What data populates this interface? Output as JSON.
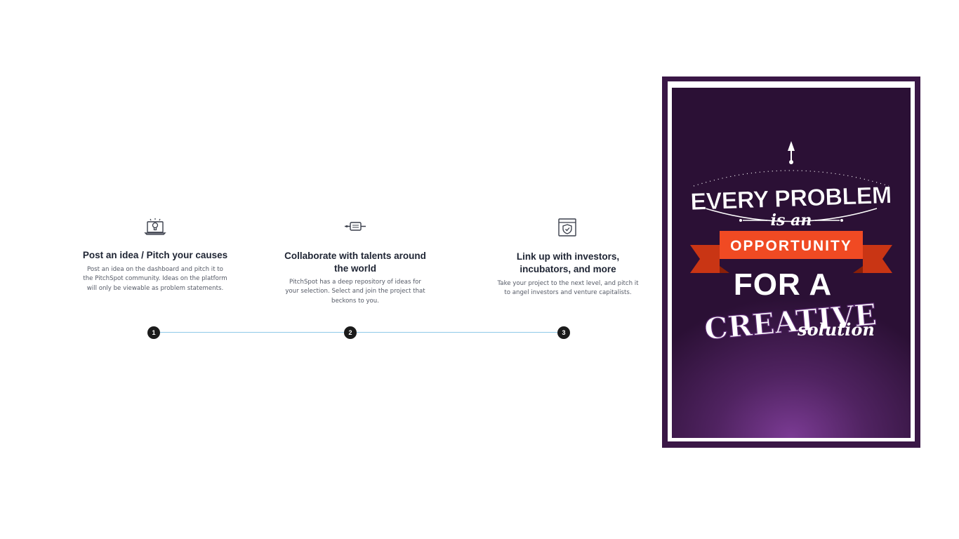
{
  "steps": [
    {
      "icon": "laptop-lightbulb-icon",
      "title": "Post an idea / Pitch your causes",
      "description_lines": [
        "Post an idea on the dashboard and pitch it to",
        "the PitchSpot community. Ideas on the platform",
        "will only be viewable as problem statements."
      ]
    },
    {
      "icon": "collaboration-pipe-icon",
      "title_lines": [
        "Collaborate with talents around",
        "the world"
      ],
      "description_lines": [
        "PitchSpot has a deep repository of ideas for",
        "your selection. Select and join the project that",
        "beckons to you."
      ]
    },
    {
      "icon": "shield-browser-icon",
      "title_lines": [
        "Link up with investors,",
        "incubators, and more"
      ],
      "description_lines": [
        "Take your project to the next level, and pitch it",
        "to angel investors and venture capitalists."
      ]
    }
  ],
  "timeline": {
    "numbers": [
      "1",
      "2",
      "3"
    ],
    "line_color": "#8fc9e8",
    "dot_color": "#1b1b1b"
  },
  "poster": {
    "line_1": "EVERY PROBLEM",
    "line_2": "is an",
    "line_3": "OPPORTUNITY",
    "line_4": "FOR A",
    "line_5": "CREATIVE",
    "line_6": "solution",
    "background_color": "#3a1746",
    "ribbon_color": "#f04a23",
    "icon": "arrow-up-icon"
  }
}
